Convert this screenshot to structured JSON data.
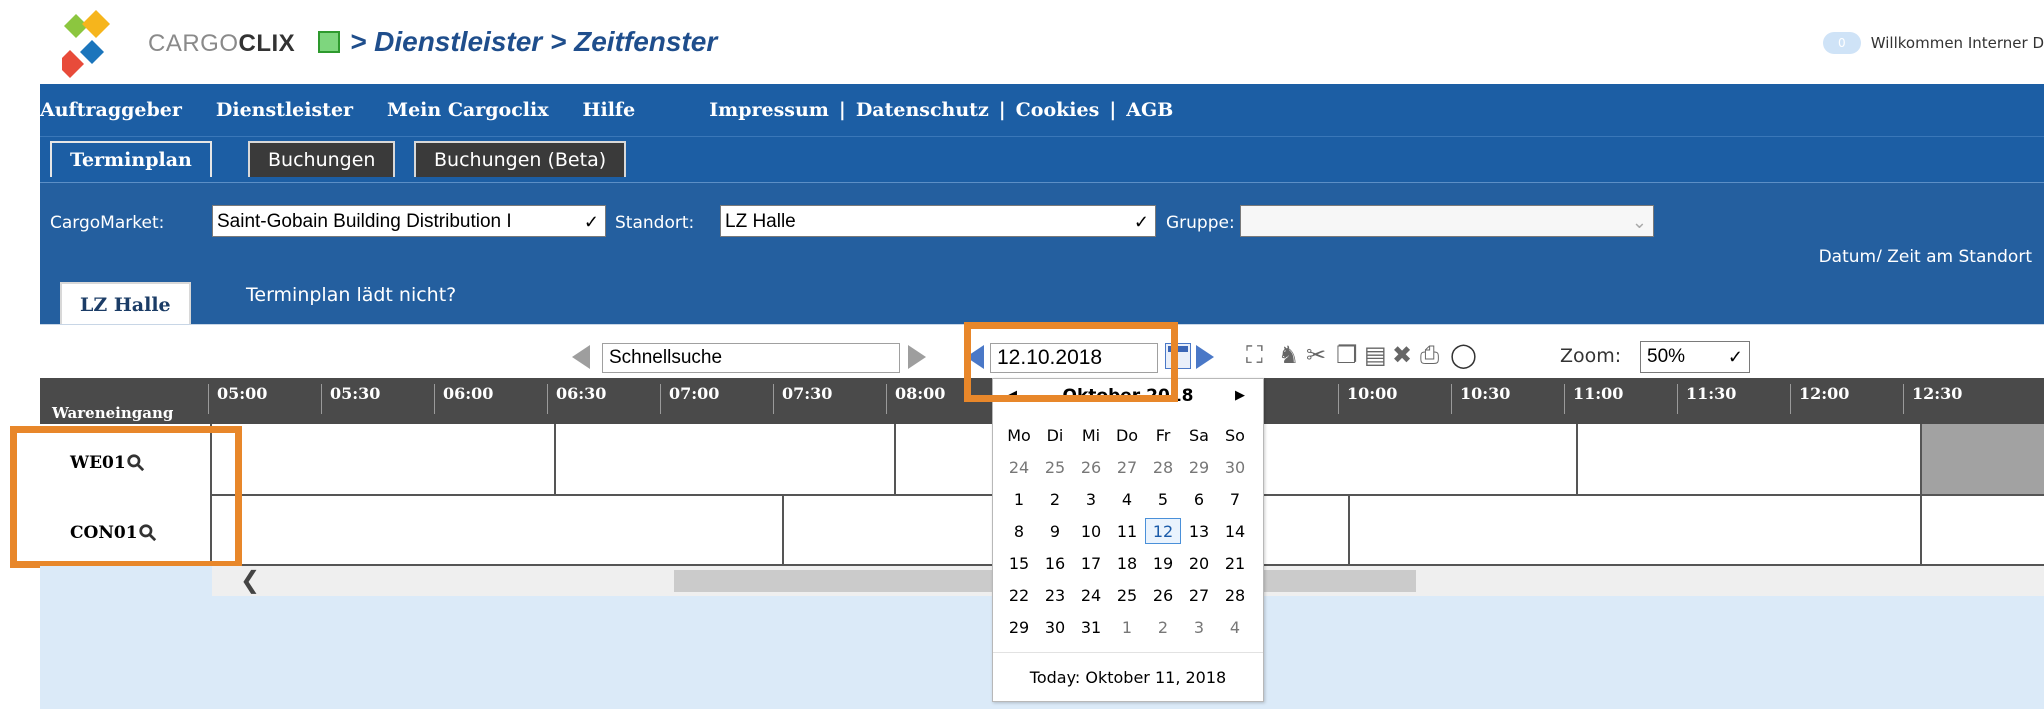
{
  "header": {
    "logo_text_light": "CARGO",
    "logo_text_bold": "CLIX",
    "breadcrumb": "> Dienstleister > Zeitfenster",
    "welcome_badge": "0",
    "welcome_text": "Willkommen Interner D"
  },
  "nav": {
    "items": [
      "Auftraggeber",
      "Dienstleister",
      "Mein Cargoclix",
      "Hilfe"
    ],
    "links": [
      "Impressum",
      "Datenschutz",
      "Cookies",
      "AGB"
    ],
    "separator": "|"
  },
  "tabs": [
    "Terminplan",
    "Buchungen",
    "Buchungen (Beta)"
  ],
  "filters": {
    "cargomarket_label": "CargoMarket:",
    "cargomarket_value": "Saint-Gobain Building Distribution I",
    "standort_label": "Standort:",
    "standort_value": "LZ Halle",
    "gruppe_label": "Gruppe:",
    "gruppe_value": "",
    "datum_label": "Datum/ Zeit am Standort"
  },
  "location": {
    "tab": "LZ Halle",
    "help_link": "Terminplan lädt nicht?"
  },
  "toolbar": {
    "search_value": "Schnellsuche",
    "date_value": "12.10.2018",
    "zoom_label": "Zoom:",
    "zoom_value": "50%"
  },
  "schedule": {
    "area_label": "Wareneingang",
    "times": [
      "05:00",
      "05:30",
      "06:00",
      "06:30",
      "07:00",
      "07:30",
      "08:00",
      "10:00",
      "10:30",
      "11:00",
      "11:30",
      "12:00",
      "12:30"
    ],
    "rows": [
      "WE01",
      "CON01"
    ]
  },
  "calendar": {
    "month_label": "Oktober 2018",
    "weekdays": [
      "Mo",
      "Di",
      "Mi",
      "Do",
      "Fr",
      "Sa",
      "So"
    ],
    "weeks": [
      [
        "24",
        "25",
        "26",
        "27",
        "28",
        "29",
        "30"
      ],
      [
        "1",
        "2",
        "3",
        "4",
        "5",
        "6",
        "7"
      ],
      [
        "8",
        "9",
        "10",
        "11",
        "12",
        "13",
        "14"
      ],
      [
        "15",
        "16",
        "17",
        "18",
        "19",
        "20",
        "21"
      ],
      [
        "22",
        "23",
        "24",
        "25",
        "26",
        "27",
        "28"
      ],
      [
        "29",
        "30",
        "31",
        "1",
        "2",
        "3",
        "4"
      ]
    ],
    "selected_day": "12",
    "today_text": "Today: Oktober 11, 2018"
  },
  "colors": {
    "nav_blue": "#1c5ea4",
    "highlight_orange": "#e8872a",
    "schedule_header": "#4a4a4a"
  }
}
